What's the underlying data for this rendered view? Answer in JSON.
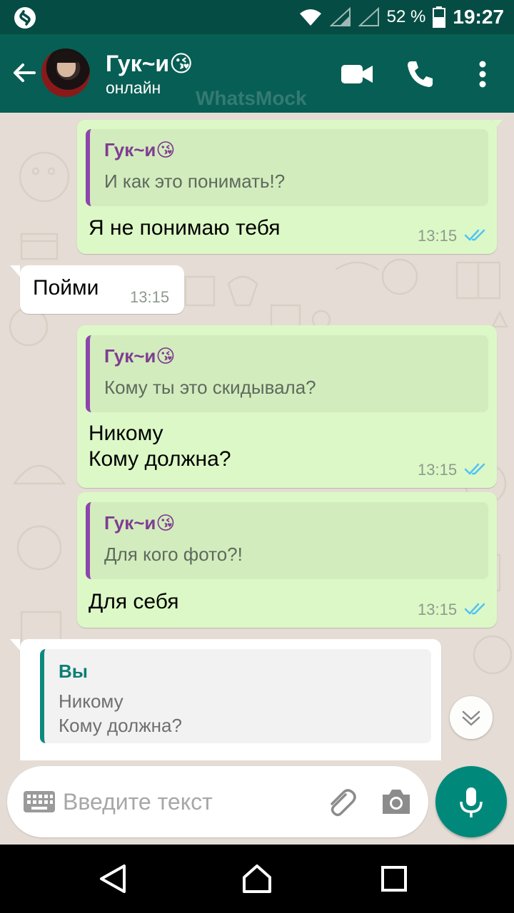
{
  "status_bar": {
    "battery_percent": "52 %",
    "time": "19:27"
  },
  "header": {
    "contact_name": "Гук~и😘",
    "contact_status": "онлайн",
    "watermark": "WhatsMock"
  },
  "messages": [
    {
      "direction": "out",
      "quote_author": "Гук~и😘",
      "quote_text": "И как это понимать!?",
      "text": "Я не понимаю тебя",
      "time": "13:15",
      "status": "read"
    },
    {
      "direction": "in",
      "text": "Пойми",
      "time": "13:15"
    },
    {
      "direction": "out",
      "quote_author": "Гук~и😘",
      "quote_text": "Кому ты это скидывала?",
      "text": "Никому\nКому должна?",
      "time": "13:15",
      "status": "read"
    },
    {
      "direction": "out",
      "quote_author": "Гук~и😘",
      "quote_text": "Для кого фото?!",
      "text": "Для себя",
      "time": "13:15",
      "status": "read"
    },
    {
      "direction": "in",
      "quote_author": "Вы",
      "quote_text": "Никому\nКому должна?",
      "text": "",
      "time": ""
    }
  ],
  "composer": {
    "placeholder": "Введите текст"
  },
  "icons": {
    "status_left": "shazam-icon",
    "back": "arrow-back-icon",
    "video": "video-camera-icon",
    "call": "phone-icon",
    "more": "more-vert-icon",
    "ticks": "double-check-icon",
    "scroll": "chevron-down-icon",
    "keyboard": "keyboard-icon",
    "attach": "paperclip-icon",
    "camera": "camera-icon",
    "mic": "microphone-icon"
  },
  "colors": {
    "header": "#075e54",
    "status_bar": "#054d44",
    "outgoing_bubble": "#dcf8c6",
    "incoming_bubble": "#ffffff",
    "quote_bar_contact": "#8e44ad",
    "quote_bar_self": "#0d8a7e",
    "read_ticks": "#4fc3f7",
    "mic_button": "#00897b"
  }
}
